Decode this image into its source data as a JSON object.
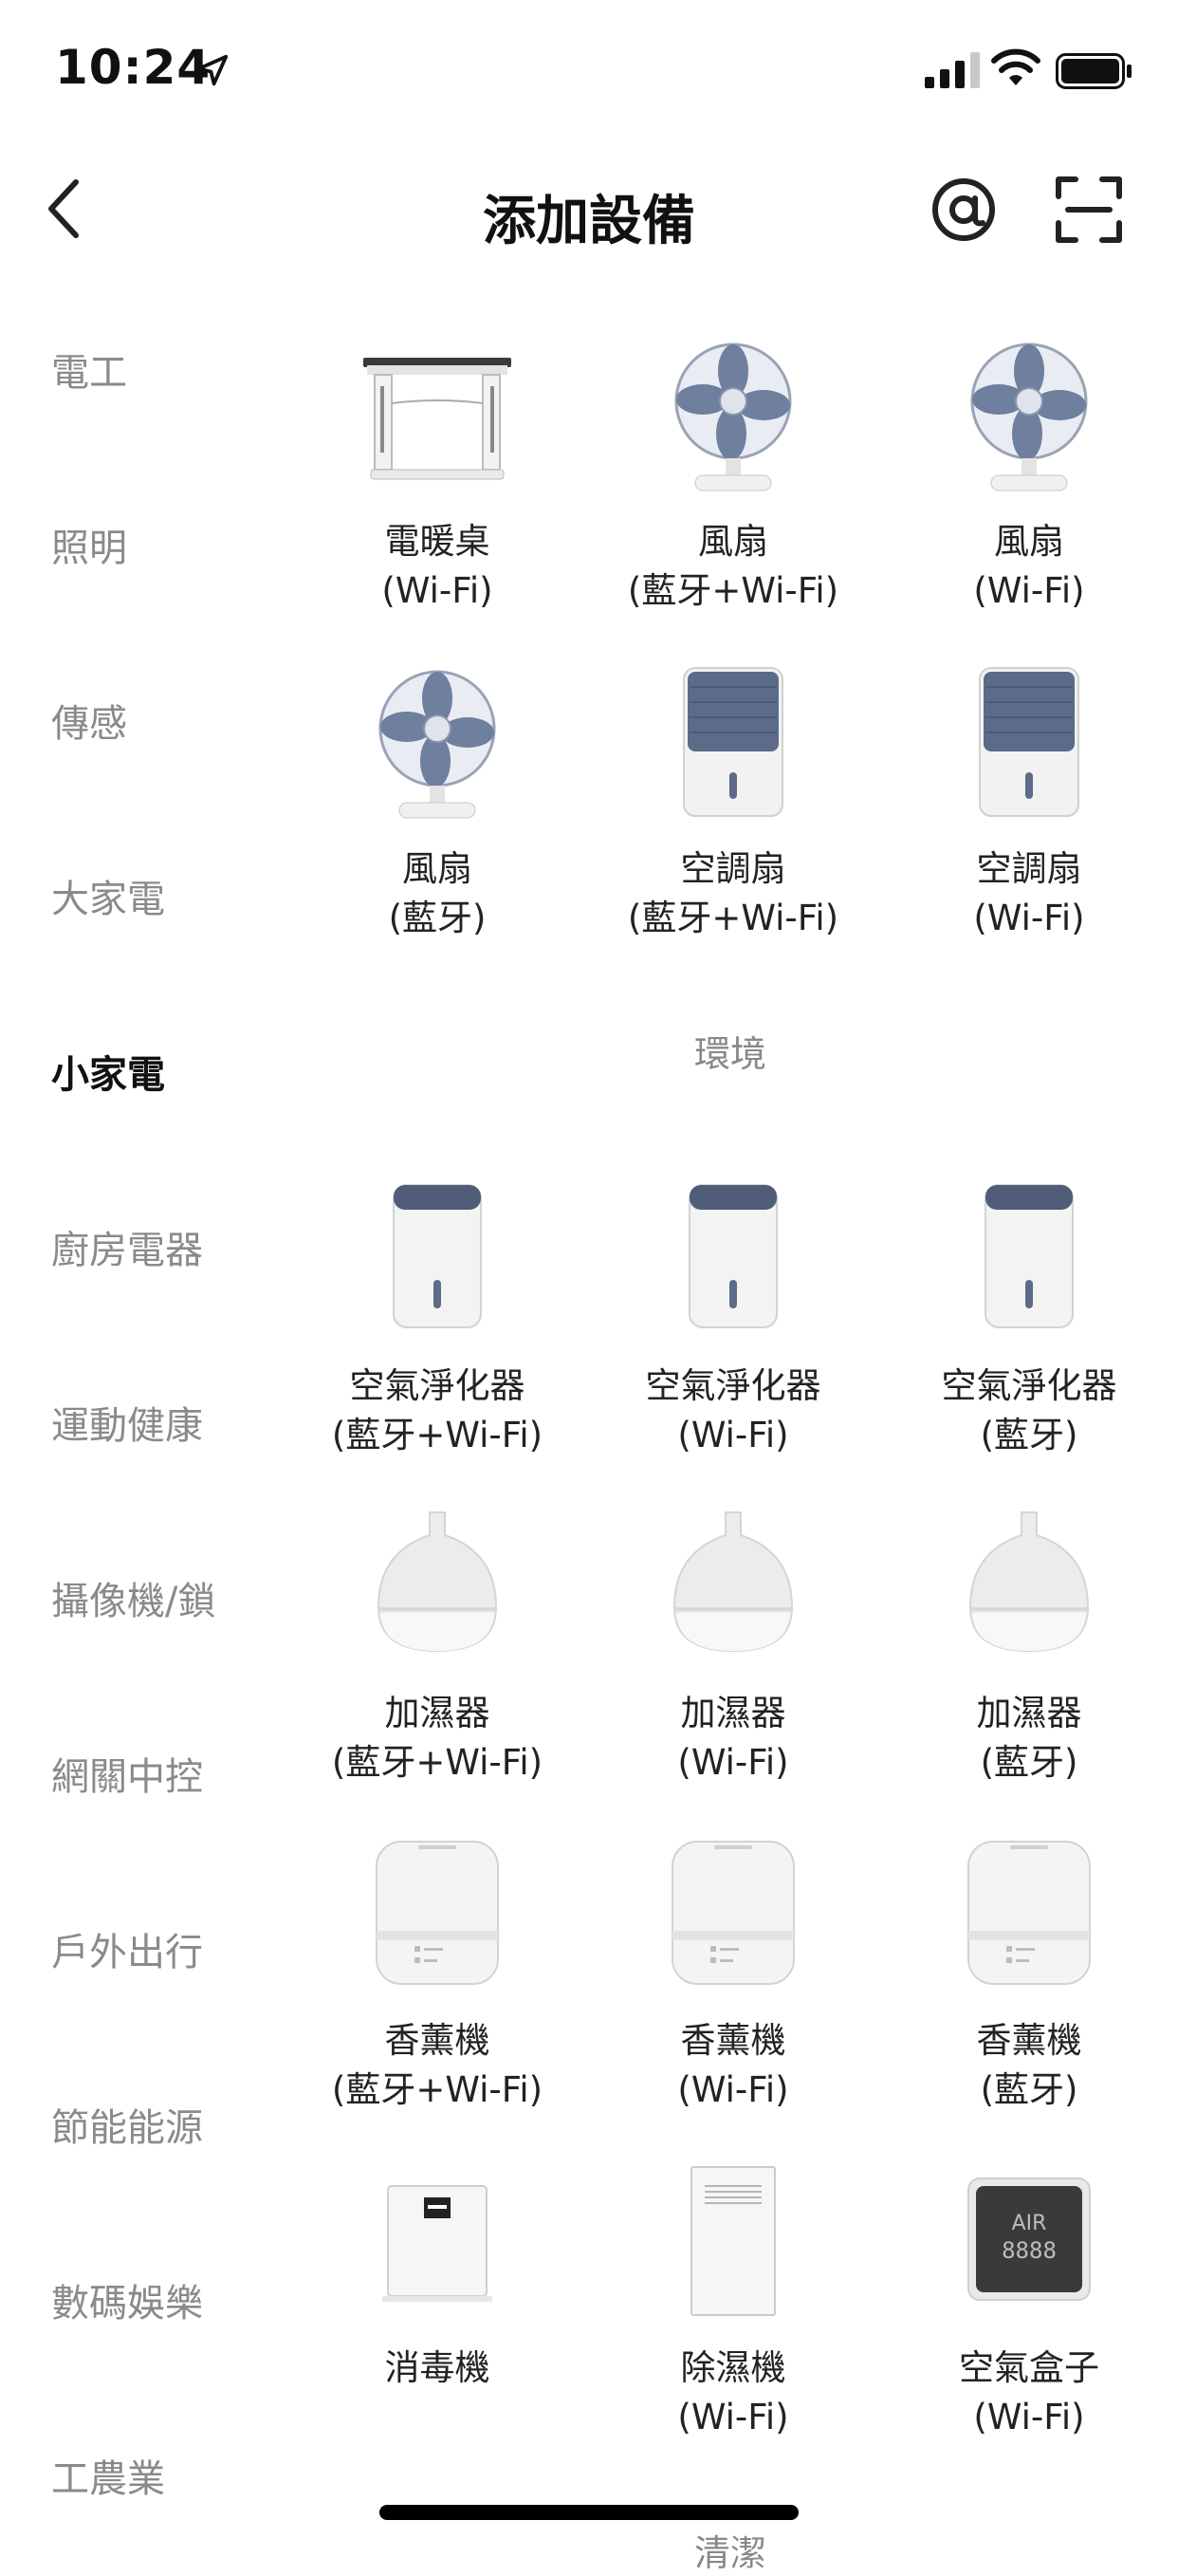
{
  "status_bar": {
    "time": "10:24",
    "icons": [
      "location-arrow-icon",
      "cellular-signal-icon",
      "wifi-icon",
      "battery-icon"
    ]
  },
  "nav": {
    "title": "添加設備",
    "icons": [
      "back-chevron-icon",
      "at-sign-icon",
      "scan-icon"
    ]
  },
  "sidebar": {
    "items": [
      {
        "label": "電工",
        "active": false
      },
      {
        "label": "照明",
        "active": false
      },
      {
        "label": "傳感",
        "active": false
      },
      {
        "label": "大家電",
        "active": false
      },
      {
        "label": "小家電",
        "active": true
      },
      {
        "label": "廚房電器",
        "active": false
      },
      {
        "label": "運動健康",
        "active": false
      },
      {
        "label": "攝像機/鎖",
        "active": false
      },
      {
        "label": "網關中控",
        "active": false
      },
      {
        "label": "戶外出行",
        "active": false
      },
      {
        "label": "節能能源",
        "active": false
      },
      {
        "label": "數碼娛樂",
        "active": false
      },
      {
        "label": "工農業",
        "active": false
      }
    ]
  },
  "content": {
    "group1": [
      {
        "name": "電暖桌",
        "conn": "(Wi-Fi)",
        "icon": "heater-desk-icon"
      },
      {
        "name": "風扇",
        "conn": "(藍牙+Wi-Fi)",
        "icon": "fan-icon"
      },
      {
        "name": "風扇",
        "conn": "(Wi-Fi)",
        "icon": "fan-icon"
      },
      {
        "name": "風扇",
        "conn": "(藍牙)",
        "icon": "fan-icon"
      },
      {
        "name": "空調扇",
        "conn": "(藍牙+Wi-Fi)",
        "icon": "air-cooler-icon"
      },
      {
        "name": "空調扇",
        "conn": "(Wi-Fi)",
        "icon": "air-cooler-icon"
      }
    ],
    "section_env": "環境",
    "group2": [
      {
        "name": "空氣淨化器",
        "conn": "(藍牙+Wi-Fi)",
        "icon": "air-purifier-icon"
      },
      {
        "name": "空氣淨化器",
        "conn": "(Wi-Fi)",
        "icon": "air-purifier-icon"
      },
      {
        "name": "空氣淨化器",
        "conn": "(藍牙)",
        "icon": "air-purifier-icon"
      },
      {
        "name": "加濕器",
        "conn": "(藍牙+Wi-Fi)",
        "icon": "humidifier-icon"
      },
      {
        "name": "加濕器",
        "conn": "(Wi-Fi)",
        "icon": "humidifier-icon"
      },
      {
        "name": "加濕器",
        "conn": "(藍牙)",
        "icon": "humidifier-icon"
      },
      {
        "name": "香薰機",
        "conn": "(藍牙+Wi-Fi)",
        "icon": "aroma-diffuser-icon"
      },
      {
        "name": "香薰機",
        "conn": "(Wi-Fi)",
        "icon": "aroma-diffuser-icon"
      },
      {
        "name": "香薰機",
        "conn": "(藍牙)",
        "icon": "aroma-diffuser-icon"
      },
      {
        "name": "消毒機",
        "conn": "",
        "icon": "sterilizer-icon"
      },
      {
        "name": "除濕機",
        "conn": "(Wi-Fi)",
        "icon": "dehumidifier-icon"
      },
      {
        "name": "空氣盒子",
        "conn": "(Wi-Fi)",
        "icon": "air-box-icon",
        "display_text": "AIR",
        "display_digits": "8888"
      }
    ],
    "section_clean": "清潔"
  },
  "colors": {
    "accent_dark": "#111111",
    "muted": "#8a8a8a",
    "device_slate": "#5b6b88",
    "device_white": "#f2f2f2"
  }
}
